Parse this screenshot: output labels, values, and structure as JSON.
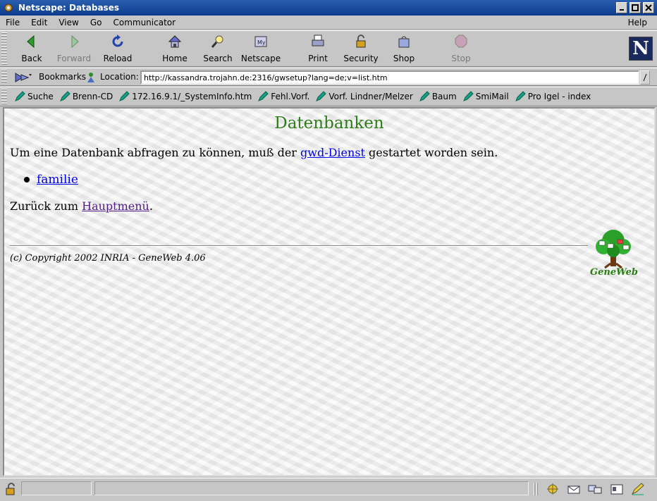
{
  "window": {
    "title": "Netscape: Databases"
  },
  "menu": {
    "items": [
      "File",
      "Edit",
      "View",
      "Go",
      "Communicator"
    ],
    "help": "Help"
  },
  "toolbar": {
    "back": "Back",
    "forward": "Forward",
    "reload": "Reload",
    "home": "Home",
    "search": "Search",
    "netscape": "Netscape",
    "print": "Print",
    "security": "Security",
    "shop": "Shop",
    "stop": "Stop"
  },
  "location": {
    "bookmarks_label": "Bookmarks",
    "location_label": "Location:",
    "url": "http://kassandra.trojahn.de:2316/gwsetup?lang=de;v=list.htm"
  },
  "personal_toolbar": {
    "items": [
      "Suche",
      "Brenn-CD",
      "172.16.9.1/_SystemInfo.htm",
      "Fehl.Vorf.",
      "Vorf. Lindner/Melzer",
      "Baum",
      "SmiMail",
      "Pro Igel - index"
    ]
  },
  "page": {
    "title": "Datenbanken",
    "intro_before": "Um eine Datenbank abfragen zu können, muß der ",
    "intro_link": "gwd-Dienst",
    "intro_after": " gestartet worden sein.",
    "databases": [
      "familie"
    ],
    "back_before": "Zurück zum ",
    "back_link": "Hauptmenü",
    "back_after": ".",
    "copyright": "(c) Copyright 2002 INRIA - GeneWeb 4.06",
    "logo_text": "GeneWeb"
  },
  "colors": {
    "title_green": "#2e7d1a",
    "link": "#0000ee",
    "visited_link": "#551a8b",
    "titlebar": "#1c4a9e"
  }
}
